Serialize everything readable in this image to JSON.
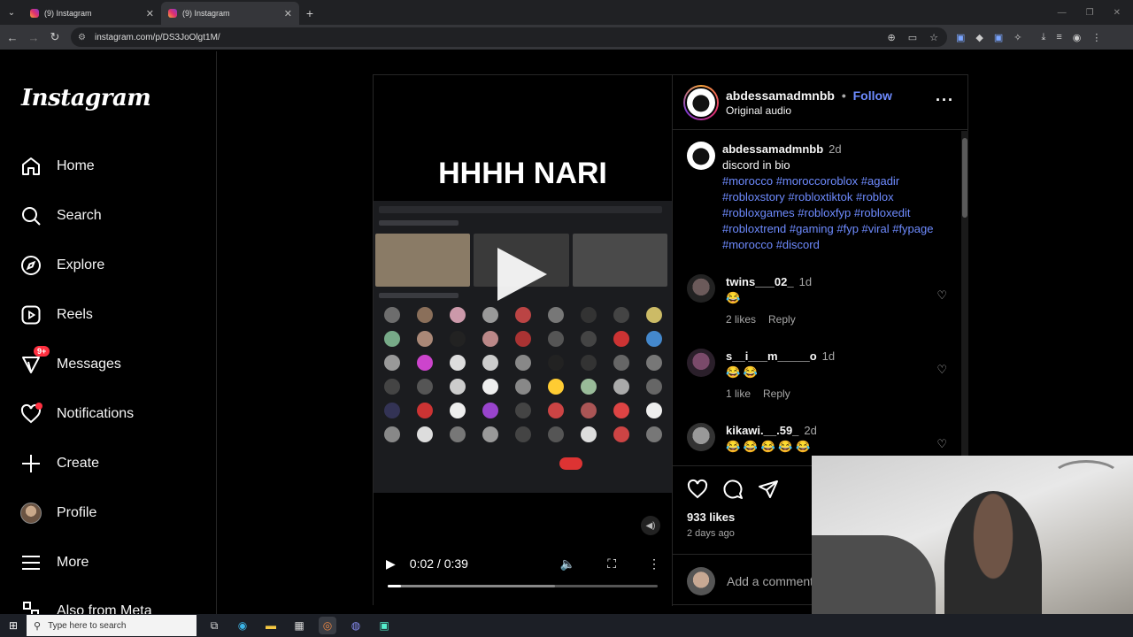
{
  "browser": {
    "tabs": [
      {
        "title": "(9) Instagram",
        "active": false
      },
      {
        "title": "(9) Instagram",
        "active": true
      }
    ],
    "url": "instagram.com/p/DS3JoOlgt1M/"
  },
  "sidebar": {
    "logo": "Instagram",
    "items": [
      {
        "label": "Home",
        "icon": "home-icon"
      },
      {
        "label": "Search",
        "icon": "search-icon"
      },
      {
        "label": "Explore",
        "icon": "compass-icon"
      },
      {
        "label": "Reels",
        "icon": "reels-icon"
      },
      {
        "label": "Messages",
        "icon": "messenger-icon",
        "badge": "9+"
      },
      {
        "label": "Notifications",
        "icon": "heart-icon"
      },
      {
        "label": "Create",
        "icon": "plus-icon"
      },
      {
        "label": "Profile",
        "icon": "avatar"
      },
      {
        "label": "More",
        "icon": "menu-icon"
      },
      {
        "label": "Also from Meta",
        "icon": "meta-icon"
      }
    ]
  },
  "video": {
    "overlay_text": "HHHH NARI",
    "current_time": "0:02",
    "duration": "0:39",
    "time_display": "0:02 / 0:39",
    "progress": 0.05,
    "buffered": 0.62
  },
  "post": {
    "username": "abdessamadmnbb",
    "follow_label": "Follow",
    "separator": "•",
    "audio": "Original audio",
    "caption": {
      "username": "abdessamadmnbb",
      "ago": "2d",
      "text": "discord in bio",
      "hashtags": "#morocco #moroccoroblox #agadir #robloxstory #robloxtiktok #roblox #robloxgames #robloxfyp #robloxedit #robloxtrend #gaming #fyp #viral #fypage #morocco #discord"
    },
    "comments": [
      {
        "username": "twins___02_",
        "ago": "1d",
        "text": "😂",
        "likes": "2 likes",
        "reply": "Reply"
      },
      {
        "username": "s__i___m_____o",
        "ago": "1d",
        "text": "😂 😂",
        "likes": "1 like",
        "reply": "Reply"
      },
      {
        "username": "kikawi.__.59_",
        "ago": "2d",
        "text": "😂 😂 😂 😂 😂",
        "likes": "",
        "reply": ""
      }
    ],
    "likes": "933 likes",
    "posted": "2 days ago",
    "add_comment_placeholder": "Add a comment..."
  },
  "taskbar": {
    "search_placeholder": "Type here to search"
  }
}
